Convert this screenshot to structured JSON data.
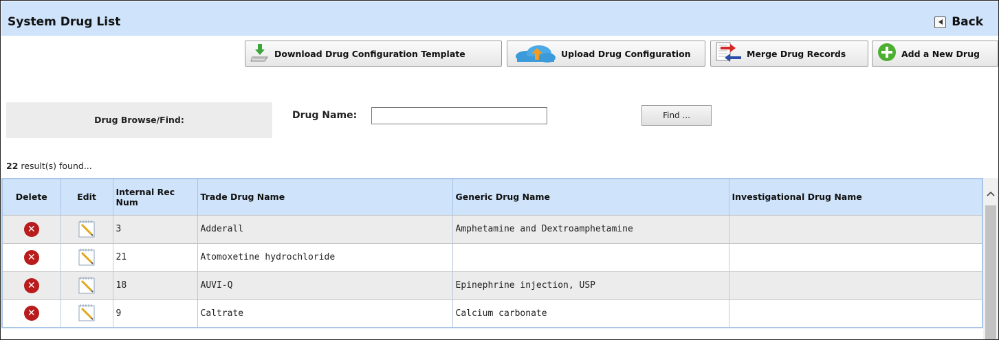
{
  "header": {
    "title": "System Drug List",
    "back_label": "Back"
  },
  "toolbar": {
    "download_label": "Download Drug Configuration Template",
    "upload_label": "Upload Drug Configuration",
    "merge_label": "Merge Drug Records",
    "add_label": "Add a New Drug"
  },
  "search": {
    "section_label": "Drug Browse/Find:",
    "drug_name_label": "Drug Name:",
    "drug_name_value": "",
    "find_label": "Find ..."
  },
  "results": {
    "count": "22",
    "suffix": "result(s) found..."
  },
  "table": {
    "columns": [
      "Delete",
      "Edit",
      "Internal Rec Num",
      "Trade Drug Name",
      "Generic Drug Name",
      "Investigational Drug Name"
    ],
    "rows": [
      {
        "rec": "3",
        "trade": "Adderall",
        "generic": "Amphetamine and Dextroamphetamine",
        "investigational": ""
      },
      {
        "rec": "21",
        "trade": "Atomoxetine hydrochloride",
        "generic": "",
        "investigational": ""
      },
      {
        "rec": "18",
        "trade": "AUVI-Q",
        "generic": "Epinephrine injection, USP",
        "investigational": ""
      },
      {
        "rec": "9",
        "trade": "Caltrate",
        "generic": "Calcium carbonate",
        "investigational": ""
      }
    ]
  },
  "icons": {
    "delete": "delete-x-icon",
    "edit": "notepad-edit-icon",
    "back": "back-arrow-icon",
    "download": "download-arrow-icon",
    "upload": "cloud-upload-icon",
    "merge": "merge-arrows-icon",
    "add": "plus-circle-icon"
  },
  "colors": {
    "header_bg": "#cfe3fa",
    "delete_red": "#b81c1c",
    "add_green": "#4caf30"
  }
}
